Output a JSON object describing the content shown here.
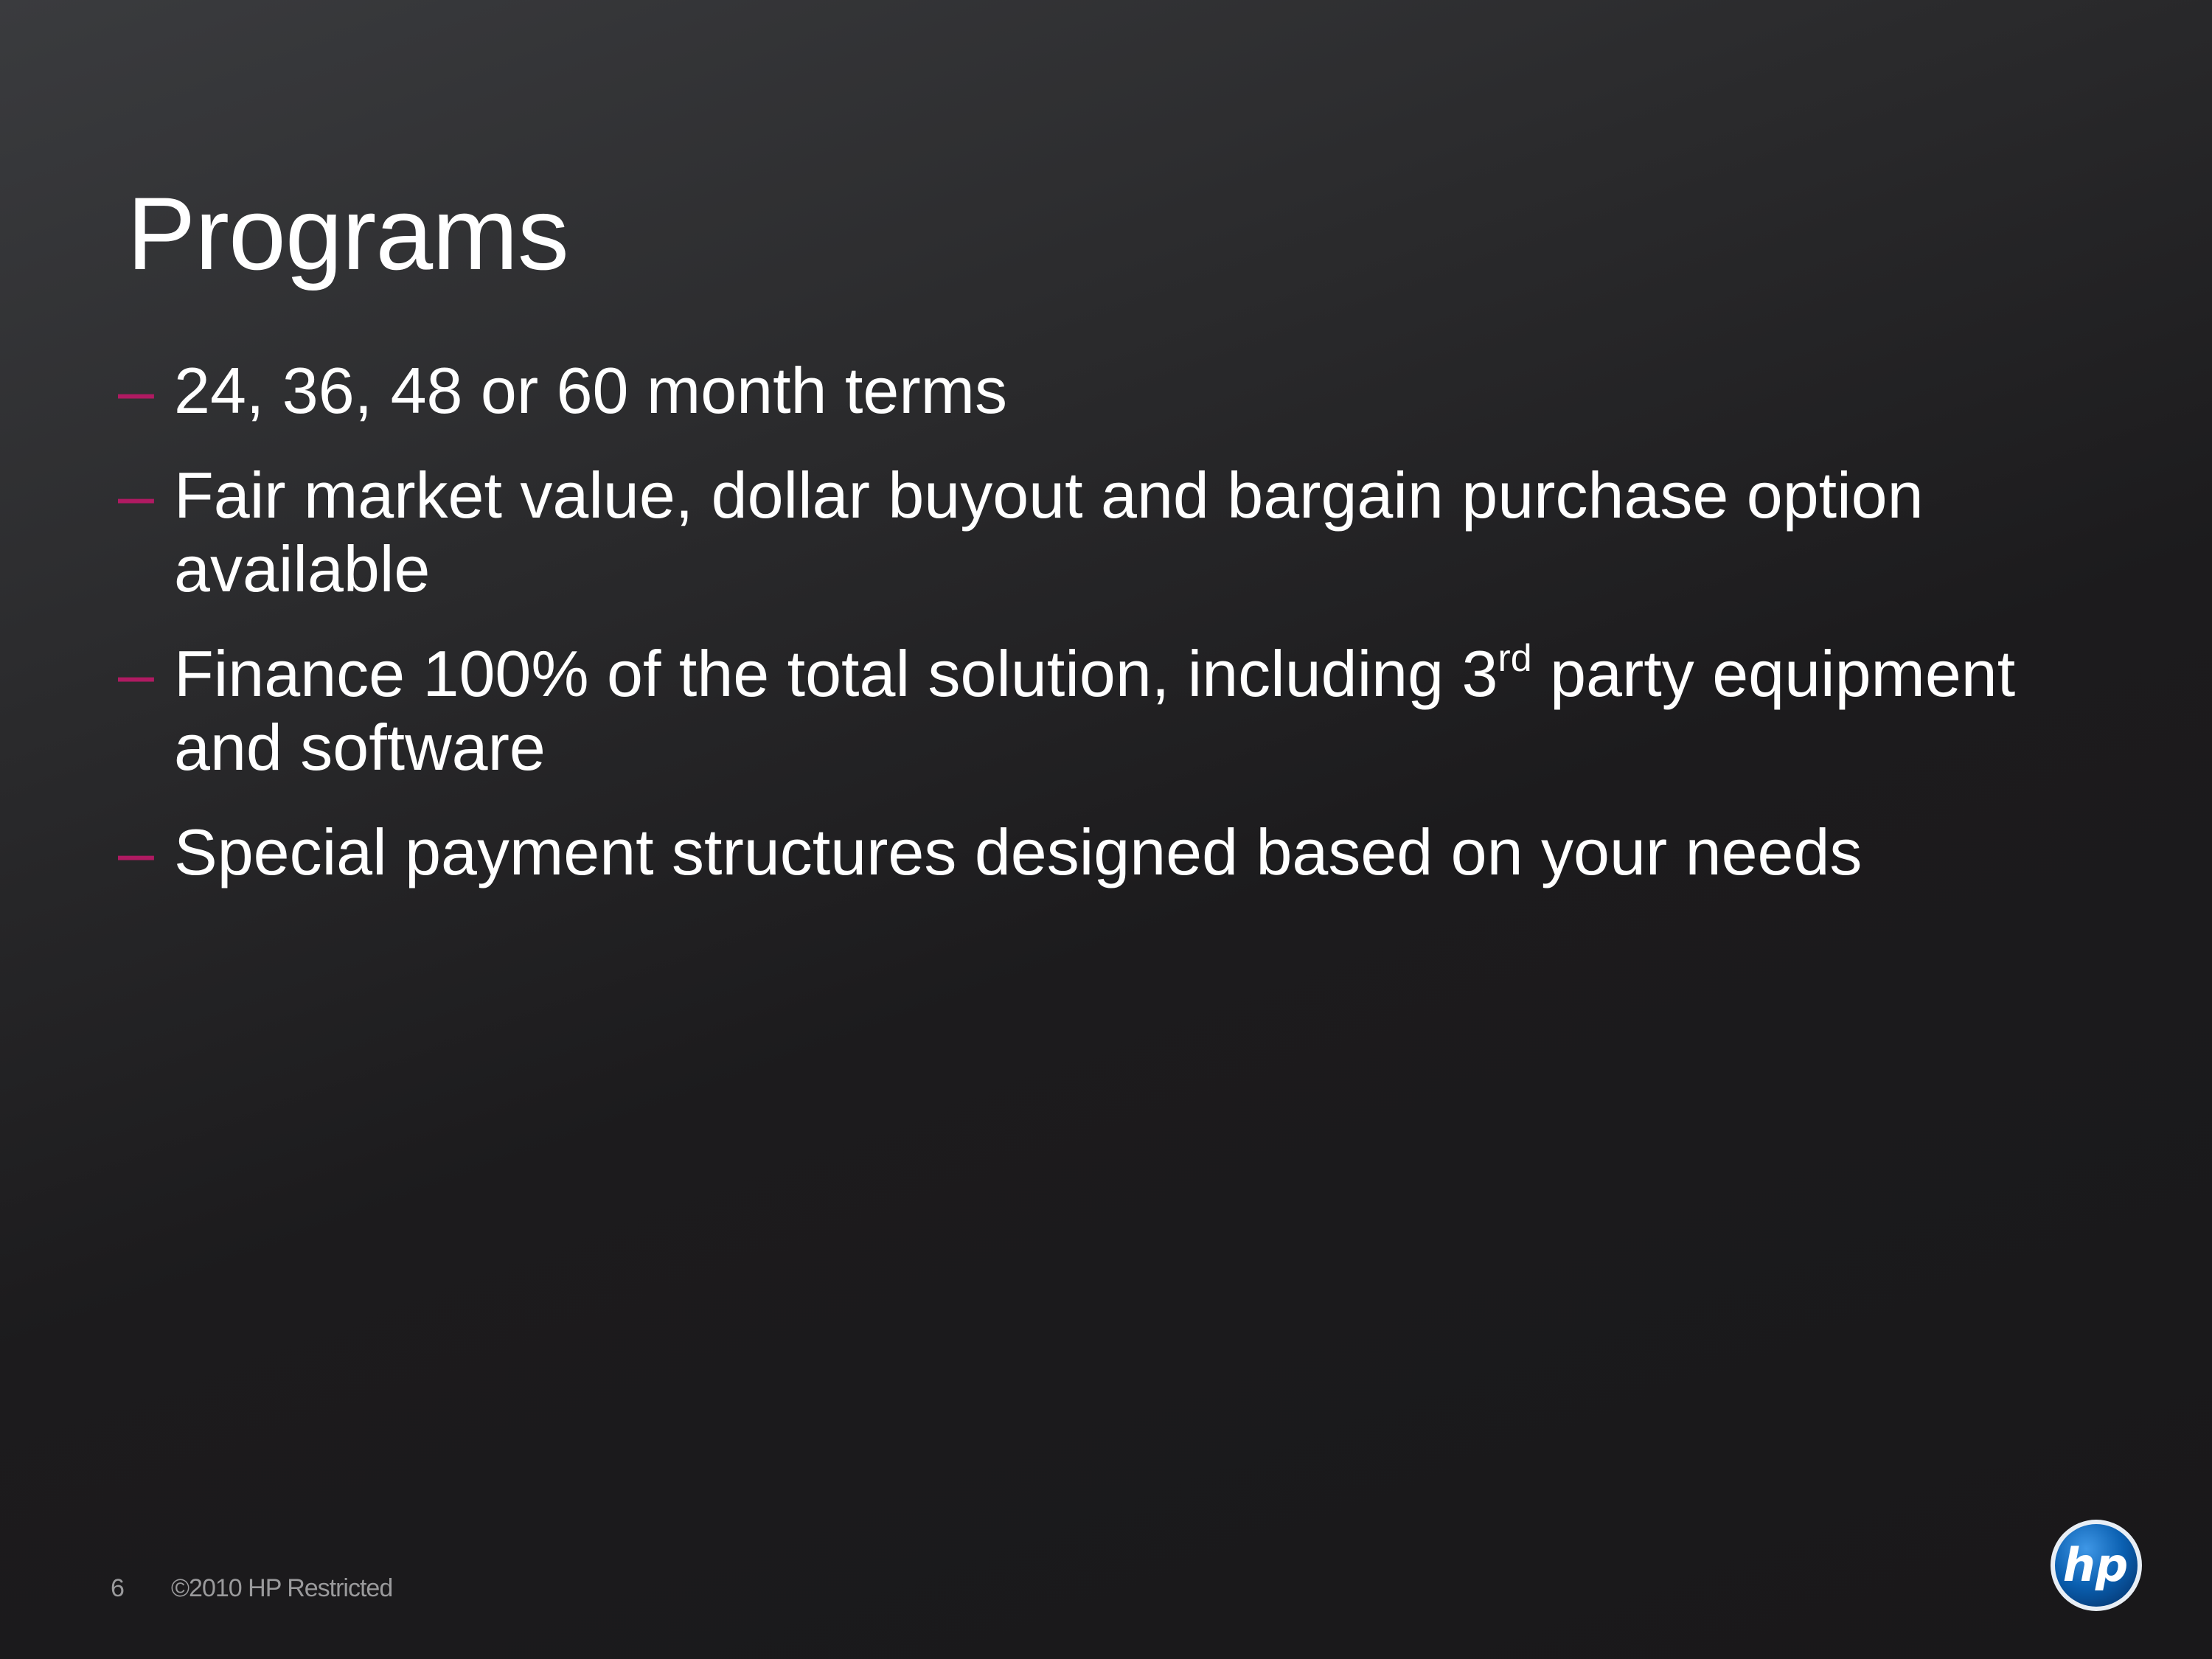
{
  "slide": {
    "title": "Programs",
    "bullets": [
      {
        "text": "24, 36, 48 or 60 month terms"
      },
      {
        "text": "Fair market value, dollar buyout and bargain purchase option available"
      },
      {
        "pre": "Finance 100% of the total solution, including 3",
        "sup": "rd",
        "post": " party equipment and software"
      },
      {
        "text": "Special payment structures designed based on your needs"
      }
    ],
    "bullet_marker": "–",
    "page_number": "6",
    "footer": "©2010 HP Restricted",
    "logo_text": "hp",
    "colors": {
      "accent": "#b01a62",
      "logo_blue": "#0a5fb0"
    }
  }
}
